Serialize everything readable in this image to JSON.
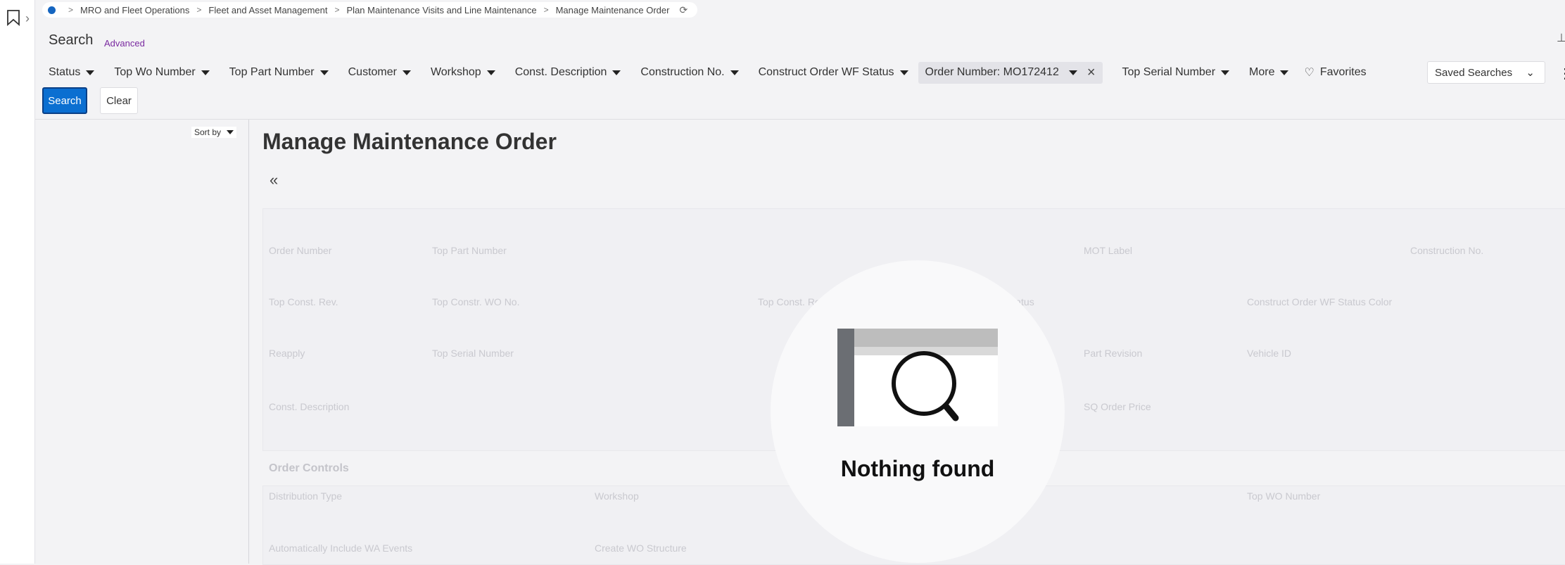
{
  "breadcrumb": {
    "items": [
      "MRO and Fleet Operations",
      "Fleet and Asset Management",
      "Plan Maintenance Visits and Line Maintenance",
      "Manage Maintenance Order"
    ]
  },
  "search": {
    "title": "Search",
    "advanced_label": "Advanced",
    "filters": [
      {
        "label": "Status"
      },
      {
        "label": "Top Wo Number"
      },
      {
        "label": "Top Part Number"
      },
      {
        "label": "Customer"
      },
      {
        "label": "Workshop"
      },
      {
        "label": "Const. Description"
      },
      {
        "label": "Construction No."
      },
      {
        "label": "Construct Order WF Status"
      }
    ],
    "active_chip": "Order Number: MO172412",
    "filters_after": [
      {
        "label": "Top Serial Number"
      },
      {
        "label": "More"
      }
    ],
    "favorites_label": "Favorites",
    "saved_searches_label": "Saved Searches",
    "search_button": "Search",
    "clear_button": "Clear"
  },
  "sort_by_label": "Sort by",
  "page_title": "Manage Maintenance Order",
  "ghost_fields": {
    "row1": [
      "Order Number",
      "Top Part Number",
      "MOT Label",
      "Construction No."
    ],
    "row2": [
      "Top Const. Rev.",
      "Top Constr. WO No.",
      "Top Const. Re",
      "Status",
      "Construct Order WF Status Color"
    ],
    "row3": [
      "Reapply",
      "Top Serial Number",
      "Part Revision",
      "Vehicle ID"
    ],
    "row4": [
      "Const. Description",
      "SQ Order Price"
    ],
    "section": "Order Controls",
    "row5": [
      "Distribution Type",
      "Workshop",
      "Top WO Number"
    ],
    "row6": [
      "Automatically Include WA Events",
      "Create WO Structure"
    ]
  },
  "empty_state": {
    "message": "Nothing found",
    "icon": "magnifier-illustration"
  },
  "colors": {
    "accent": "#0b6fd1",
    "advanced_link": "#7a2aa0",
    "background": "#f3f3f5"
  }
}
